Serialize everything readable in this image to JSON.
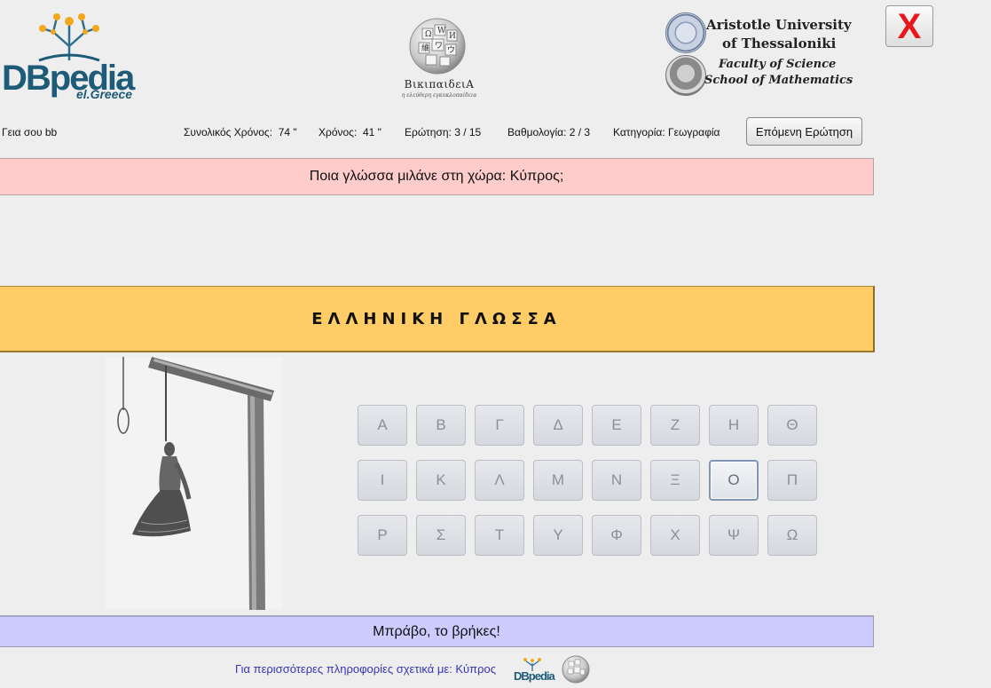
{
  "header": {
    "dbpedia_logo": {
      "word": "DBpedia",
      "sub": "el.Greece"
    },
    "wikipedia_logo": {
      "name": "ΒικιπαιδειΑ",
      "tagline": "η ελεύθερη εγκυκλοπαίδεια"
    },
    "university": {
      "line1": "Aristotle University",
      "line2": "of Thessaloniki",
      "faculty1": "Faculty of Science",
      "faculty2": "School of Mathematics"
    },
    "close_label": "X"
  },
  "status": {
    "greeting": "Γεια σου bb",
    "total_time_label": "Συνολικός Χρόνος:",
    "total_time_value": "74 \"",
    "time_label": "Χρόνος:",
    "time_value": "41 \"",
    "question_label": "Ερώτηση:",
    "question_value": "3 / 15",
    "score_label": "Βαθμολογία:",
    "score_value": "2 / 3",
    "category_label": "Κατηγορία:",
    "category_value": "Γεωγραφία",
    "next_button": "Επόμενη Ερώτηση"
  },
  "question": "Ποια γλώσσα μιλάνε στη χώρα: Κύπρος;",
  "answer": "ΕΛΛΗΝΙΚΗ ΓΛΩΣΣΑ",
  "letters": [
    [
      "Α",
      "Β",
      "Γ",
      "Δ",
      "Ε",
      "Ζ",
      "Η",
      "Θ"
    ],
    [
      "Ι",
      "Κ",
      "Λ",
      "Μ",
      "Ν",
      "Ξ",
      "Ο",
      "Π"
    ],
    [
      "Ρ",
      "Σ",
      "Τ",
      "Υ",
      "Φ",
      "Χ",
      "Ψ",
      "Ω"
    ]
  ],
  "focused_letter": "Ο",
  "result": "Μπράβο, το βρήκες!",
  "footer": {
    "link_text": "Για περισσότερες πληροφορίες σχετικά με: Κύπρος",
    "dbpedia_mini": "DBpedia"
  },
  "colors": {
    "question_bg": "#ffcccc",
    "answer_bg": "#ffcc66",
    "result_bg": "#ccccff",
    "close_x": "#e8171c",
    "link": "#3535b5"
  }
}
